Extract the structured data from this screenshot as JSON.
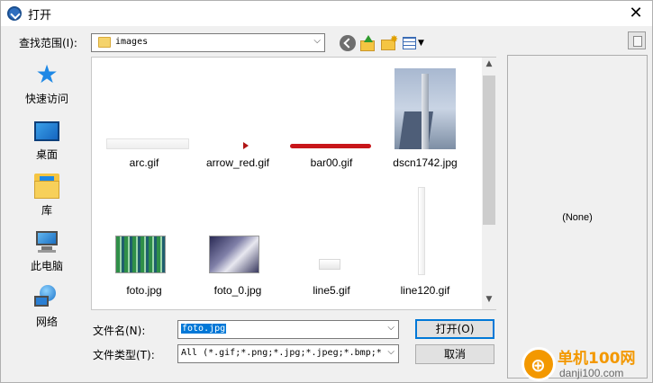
{
  "window": {
    "title": "打开",
    "close_glyph": "✕"
  },
  "toolbar": {
    "look_in_label": "查找范围(I):",
    "look_in_value": "images",
    "back_icon": "back-icon",
    "up_icon": "up-folder-icon",
    "new_folder_icon": "new-folder-icon",
    "view_menu_icon": "view-menu-icon"
  },
  "places": [
    {
      "label": "快速访问",
      "icon": "quick-access-star-icon"
    },
    {
      "label": "桌面",
      "icon": "desktop-icon"
    },
    {
      "label": "库",
      "icon": "library-icon"
    },
    {
      "label": "此电脑",
      "icon": "this-pc-icon"
    },
    {
      "label": "网络",
      "icon": "network-icon"
    }
  ],
  "files": [
    {
      "name": "arc.gif"
    },
    {
      "name": "arrow_red.gif"
    },
    {
      "name": "bar00.gif"
    },
    {
      "name": "dscn1742.jpg"
    },
    {
      "name": "foto.jpg"
    },
    {
      "name": "foto_0.jpg"
    },
    {
      "name": "line5.gif"
    },
    {
      "name": "line120.gif"
    }
  ],
  "preview": {
    "text": "(None)"
  },
  "bottom": {
    "file_name_label": "文件名(N):",
    "file_name_value": "foto.jpg",
    "file_type_label": "文件类型(T):",
    "file_type_value": "All (*.gif;*.png;*.jpg;*.jpeg;*.bmp;*",
    "open_button": "打开(O)",
    "cancel_button": "取消"
  },
  "watermark": {
    "title": "单机100网",
    "url": "danji100.com"
  },
  "colors": {
    "selection": "#0078d7",
    "accent_orange": "#f39800",
    "bar_red": "#c8161a"
  }
}
